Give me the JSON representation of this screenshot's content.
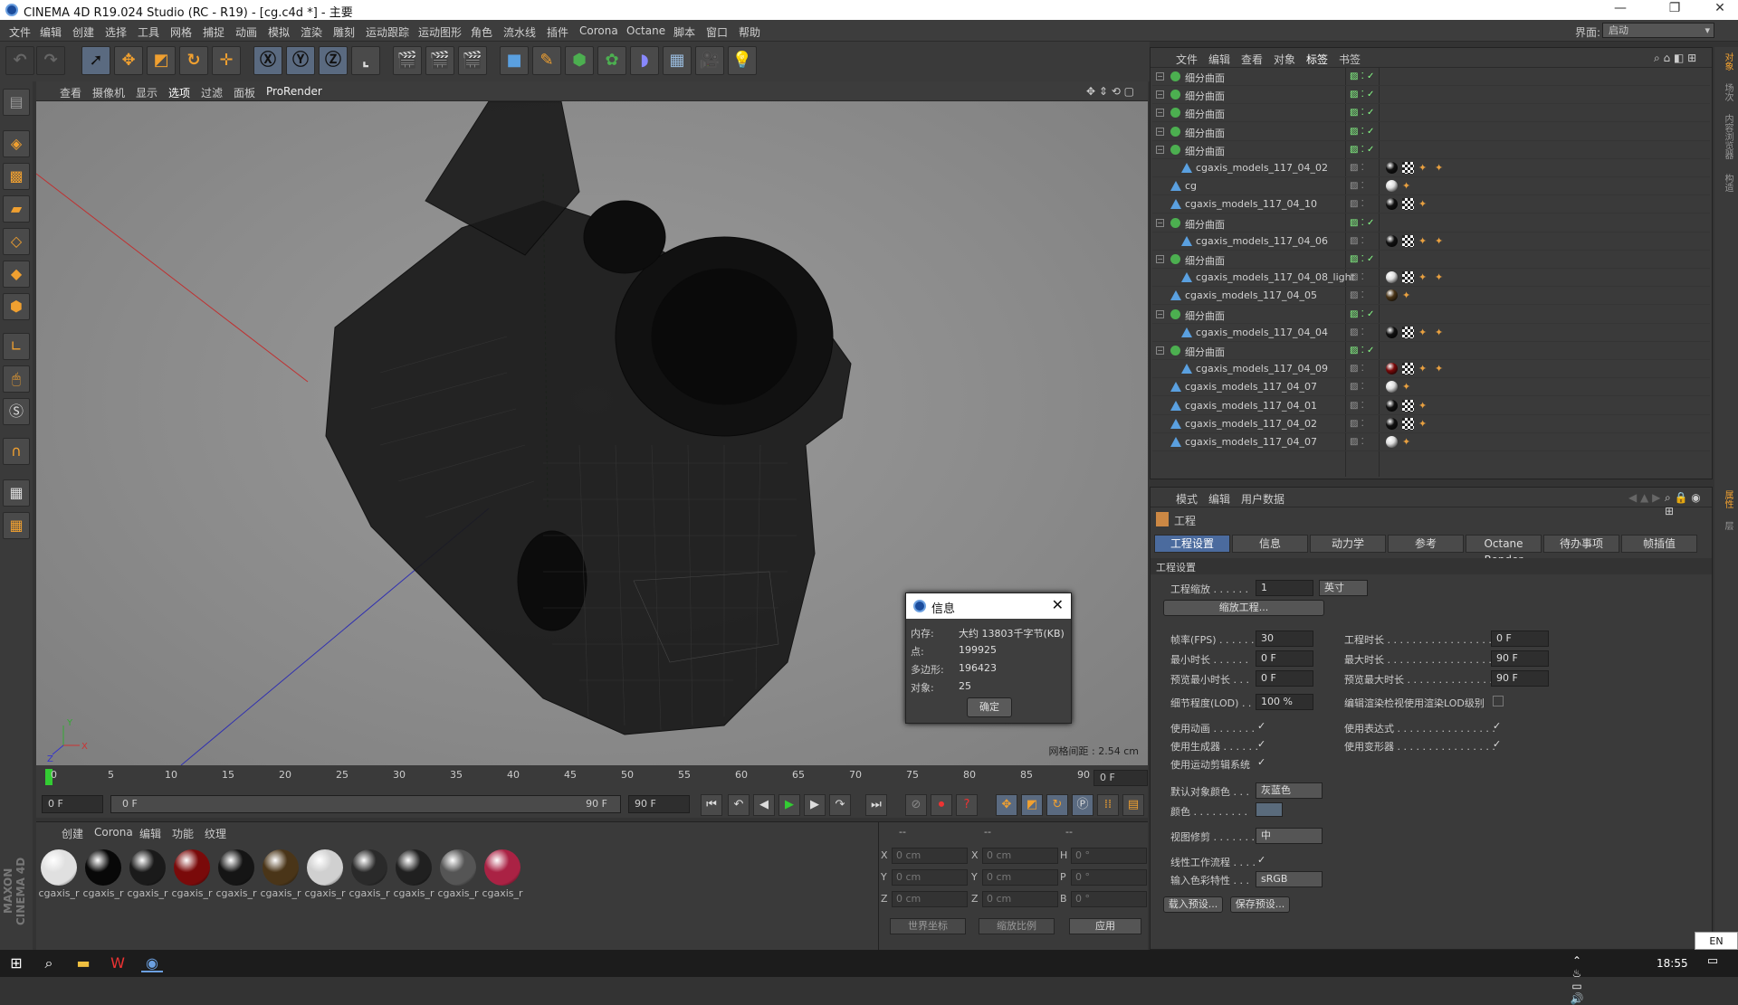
{
  "window": {
    "title": "CINEMA 4D R19.024 Studio (RC - R19) - [cg.c4d *] - 主要",
    "minimize": "—",
    "maximize": "❐",
    "close": "✕"
  },
  "menu": [
    "文件",
    "编辑",
    "创建",
    "选择",
    "工具",
    "网格",
    "捕捉",
    "动画",
    "模拟",
    "渲染",
    "雕刻",
    "运动跟踪",
    "运动图形",
    "角色",
    "流水线",
    "插件",
    "Corona",
    "Octane",
    "脚本",
    "窗口",
    "帮助"
  ],
  "interface": {
    "label": "界面:",
    "value": "启动"
  },
  "viewport": {
    "menu": [
      "查看",
      "摄像机",
      "显示",
      "选项",
      "过滤",
      "面板",
      "ProRender"
    ],
    "grid_spacing": "网格间距 : 2.54 cm",
    "axis": {
      "x": "X",
      "y": "Y",
      "z": "Z"
    }
  },
  "info_dialog": {
    "title": "信息",
    "close": "✕",
    "rows": [
      {
        "label": "内存:",
        "value": "大约 13803千字节(KB)"
      },
      {
        "label": "点:",
        "value": "199925"
      },
      {
        "label": "多边形:",
        "value": "196423"
      },
      {
        "label": "对象:",
        "value": "25"
      }
    ],
    "ok": "确定"
  },
  "timeline": {
    "ticks": [
      "0",
      "5",
      "10",
      "15",
      "20",
      "25",
      "30",
      "35",
      "40",
      "45",
      "50",
      "55",
      "60",
      "65",
      "70",
      "75",
      "80",
      "85",
      "90"
    ],
    "current": "0 F"
  },
  "transport": {
    "start": "0 F",
    "range_start": "0 F",
    "range_end": "90 F",
    "end": "90 F"
  },
  "material_manager": {
    "menu": [
      "创建",
      "Corona",
      "编辑",
      "功能",
      "纹理"
    ],
    "materials": [
      {
        "label": "cgaxis_r",
        "color": "#e0e0e0"
      },
      {
        "label": "cgaxis_r",
        "color": "#080808"
      },
      {
        "label": "cgaxis_r",
        "color": "#1a1a1a"
      },
      {
        "label": "cgaxis_r",
        "color": "#7a0a0a"
      },
      {
        "label": "cgaxis_r",
        "color": "#151515"
      },
      {
        "label": "cgaxis_r",
        "color": "#4a3518"
      },
      {
        "label": "cgaxis_r",
        "color": "#d0d0d0"
      },
      {
        "label": "cgaxis_r",
        "color": "#2a2a2a"
      },
      {
        "label": "cgaxis_r",
        "color": "#202020"
      },
      {
        "label": "cgaxis_r",
        "color": "#555555"
      },
      {
        "label": "cgaxis_r",
        "color": "#aa2244"
      }
    ]
  },
  "coordinates": {
    "header": [
      "--",
      "--",
      "--"
    ],
    "rows": [
      {
        "a": "X",
        "av": "0 cm",
        "b": "X",
        "bv": "0 cm",
        "c": "H",
        "cv": "0 °"
      },
      {
        "a": "Y",
        "av": "0 cm",
        "b": "Y",
        "bv": "0 cm",
        "c": "P",
        "cv": "0 °"
      },
      {
        "a": "Z",
        "av": "0 cm",
        "b": "Z",
        "bv": "0 cm",
        "c": "B",
        "cv": "0 °"
      }
    ],
    "world": "世界坐标",
    "scale": "缩放比例",
    "apply": "应用"
  },
  "object_manager": {
    "menu": [
      "文件",
      "编辑",
      "查看",
      "对象",
      "标签",
      "书签"
    ],
    "rows": [
      {
        "name": "细分曲面",
        "level": 0,
        "type": "subd",
        "tags": []
      },
      {
        "name": "细分曲面",
        "level": 0,
        "type": "subd",
        "tags": []
      },
      {
        "name": "细分曲面",
        "level": 0,
        "type": "subd",
        "tags": []
      },
      {
        "name": "细分曲面",
        "level": 0,
        "type": "subd",
        "tags": []
      },
      {
        "name": "细分曲面",
        "level": 0,
        "type": "subd",
        "tags": []
      },
      {
        "name": "cgaxis_models_117_04_02",
        "level": 1,
        "type": "poly",
        "tags": [
          "#111",
          "chk",
          "ph",
          "ph"
        ]
      },
      {
        "name": "cg",
        "level": 0,
        "type": "poly",
        "tags": [
          "#ddd",
          "ph"
        ]
      },
      {
        "name": "cgaxis_models_117_04_10",
        "level": 0,
        "type": "poly",
        "tags": [
          "#111",
          "chk",
          "ph"
        ]
      },
      {
        "name": "细分曲面",
        "level": 0,
        "type": "subd",
        "tags": []
      },
      {
        "name": "cgaxis_models_117_04_06",
        "level": 1,
        "type": "poly",
        "tags": [
          "#111",
          "chk",
          "ph",
          "ph"
        ]
      },
      {
        "name": "细分曲面",
        "level": 0,
        "type": "subd",
        "tags": []
      },
      {
        "name": "cgaxis_models_117_04_08_light",
        "level": 1,
        "type": "poly",
        "tags": [
          "#ddd",
          "chk",
          "ph",
          "ph"
        ]
      },
      {
        "name": "cgaxis_models_117_04_05",
        "level": 0,
        "type": "poly",
        "tags": [
          "#4a3518",
          "ph"
        ]
      },
      {
        "name": "细分曲面",
        "level": 0,
        "type": "subd",
        "tags": []
      },
      {
        "name": "cgaxis_models_117_04_04",
        "level": 1,
        "type": "poly",
        "tags": [
          "#111",
          "chk",
          "ph",
          "ph"
        ]
      },
      {
        "name": "细分曲面",
        "level": 0,
        "type": "subd",
        "tags": []
      },
      {
        "name": "cgaxis_models_117_04_09",
        "level": 1,
        "type": "poly",
        "tags": [
          "#7a0a0a",
          "chk",
          "ph",
          "ph"
        ]
      },
      {
        "name": "cgaxis_models_117_04_07",
        "level": 0,
        "type": "poly",
        "tags": [
          "#ddd",
          "ph"
        ]
      },
      {
        "name": "cgaxis_models_117_04_01",
        "level": 0,
        "type": "poly",
        "tags": [
          "#111",
          "chk",
          "ph"
        ]
      },
      {
        "name": "cgaxis_models_117_04_02",
        "level": 0,
        "type": "poly",
        "tags": [
          "#111",
          "chk",
          "ph"
        ]
      },
      {
        "name": "cgaxis_models_117_04_07",
        "level": 0,
        "type": "poly",
        "tags": [
          "#ddd",
          "ph"
        ]
      }
    ]
  },
  "attributes": {
    "menu": [
      "模式",
      "编辑",
      "用户数据"
    ],
    "heading": "工程",
    "tabs": [
      "工程设置",
      "信息",
      "动力学",
      "参考",
      "Octane Render",
      "待办事项",
      "帧插值"
    ],
    "section": "工程设置",
    "project_scale_label": "工程缩放 . . . . . .",
    "project_scale": "1",
    "project_scale_unit": "英寸",
    "scale_project_btn": "缩放工程...",
    "fps_label": "帧率(FPS) . . . . . .",
    "fps": "30",
    "project_time_label": "工程时长 . . . . . . . . . . . . . . . . .",
    "project_time": "0 F",
    "min_time_label": "最小时长 . . . . . .",
    "min_time": "0 F",
    "max_time_label": "最大时长 . . . . . . . . . . . . . . . . .",
    "max_time": "90 F",
    "preview_min_label": "预览最小时长 . . .",
    "preview_min": "0 F",
    "preview_max_label": "预览最大时长 . . . . . . . . . . . . . .",
    "preview_max": "90 F",
    "lod_label": "细节程度(LOD) . . .",
    "lod": "100 %",
    "render_lod_label": "编辑渲染检视使用渲染LOD级别",
    "use_anim_label": "使用动画 . . . . . . .",
    "use_expr_label": "使用表达式 . . . . . . . . . . . . . . . .",
    "use_gen_label": "使用生成器 . . . . . .",
    "use_deform_label": "使用变形器 . . . . . . . . . . . . . . . .",
    "use_mograph_label": "使用运动剪辑系统",
    "default_color_label": "默认对象颜色 . . .",
    "default_color": "灰蓝色",
    "color_label": "颜色 . . . . . . . . .",
    "view_clip_label": "视图修剪 . . . . . . .",
    "view_clip": "中",
    "linear_label": "线性工作流程 . . . .",
    "input_color_label": "输入色彩特性 . . .",
    "input_color": "sRGB",
    "load_preset": "载入预设...",
    "save_preset": "保存预设...",
    "check": "✓"
  },
  "right_strip": [
    "对象",
    "场次",
    "内容浏览器",
    "构造",
    "属性",
    "层"
  ],
  "taskbar": {
    "time": "18:55",
    "ime": "EN"
  },
  "colors": {
    "accent": "#4b6b9e",
    "subd_icon": "#4caf50",
    "poly_icon": "#5aa0e0"
  }
}
